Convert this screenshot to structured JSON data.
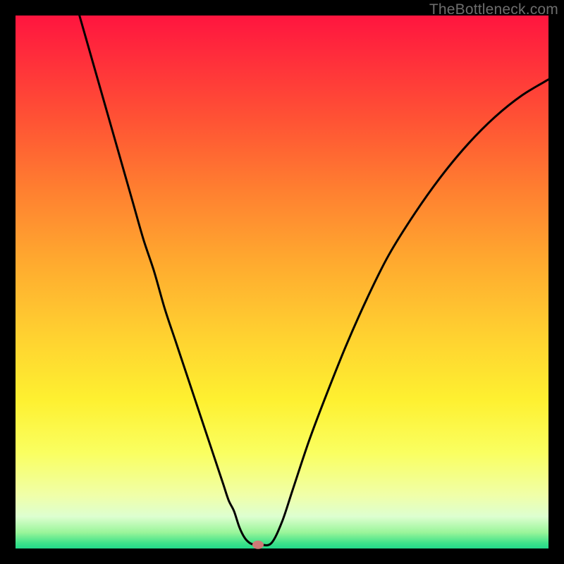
{
  "watermark": "TheBottleneck.com",
  "chart_data": {
    "type": "line",
    "title": "",
    "xlabel": "",
    "ylabel": "",
    "xlim": [
      0,
      100
    ],
    "ylim": [
      0,
      100
    ],
    "series": [
      {
        "name": "curve",
        "x": [
          12,
          14,
          16,
          18,
          20,
          22,
          24,
          26,
          28,
          30,
          32,
          34,
          36,
          37,
          38,
          39,
          40,
          41,
          42,
          43,
          44,
          45,
          46,
          48,
          50,
          52,
          55,
          58,
          62,
          66,
          70,
          75,
          80,
          85,
          90,
          95,
          100
        ],
        "y": [
          100,
          93,
          86,
          79,
          72,
          65,
          58,
          52,
          45,
          39,
          33,
          27,
          21,
          18,
          15,
          12,
          9,
          7,
          4,
          2,
          1,
          0.7,
          0.7,
          1,
          5,
          11,
          20,
          28,
          38,
          47,
          55,
          63,
          70,
          76,
          81,
          85,
          88
        ]
      }
    ],
    "marker": {
      "x": 45.5,
      "y": 0.7
    },
    "gradient_stops": [
      {
        "pos": 0,
        "color": "#ff153f"
      },
      {
        "pos": 33,
        "color": "#ff8030"
      },
      {
        "pos": 72,
        "color": "#fef030"
      },
      {
        "pos": 100,
        "color": "#24d98a"
      }
    ]
  }
}
